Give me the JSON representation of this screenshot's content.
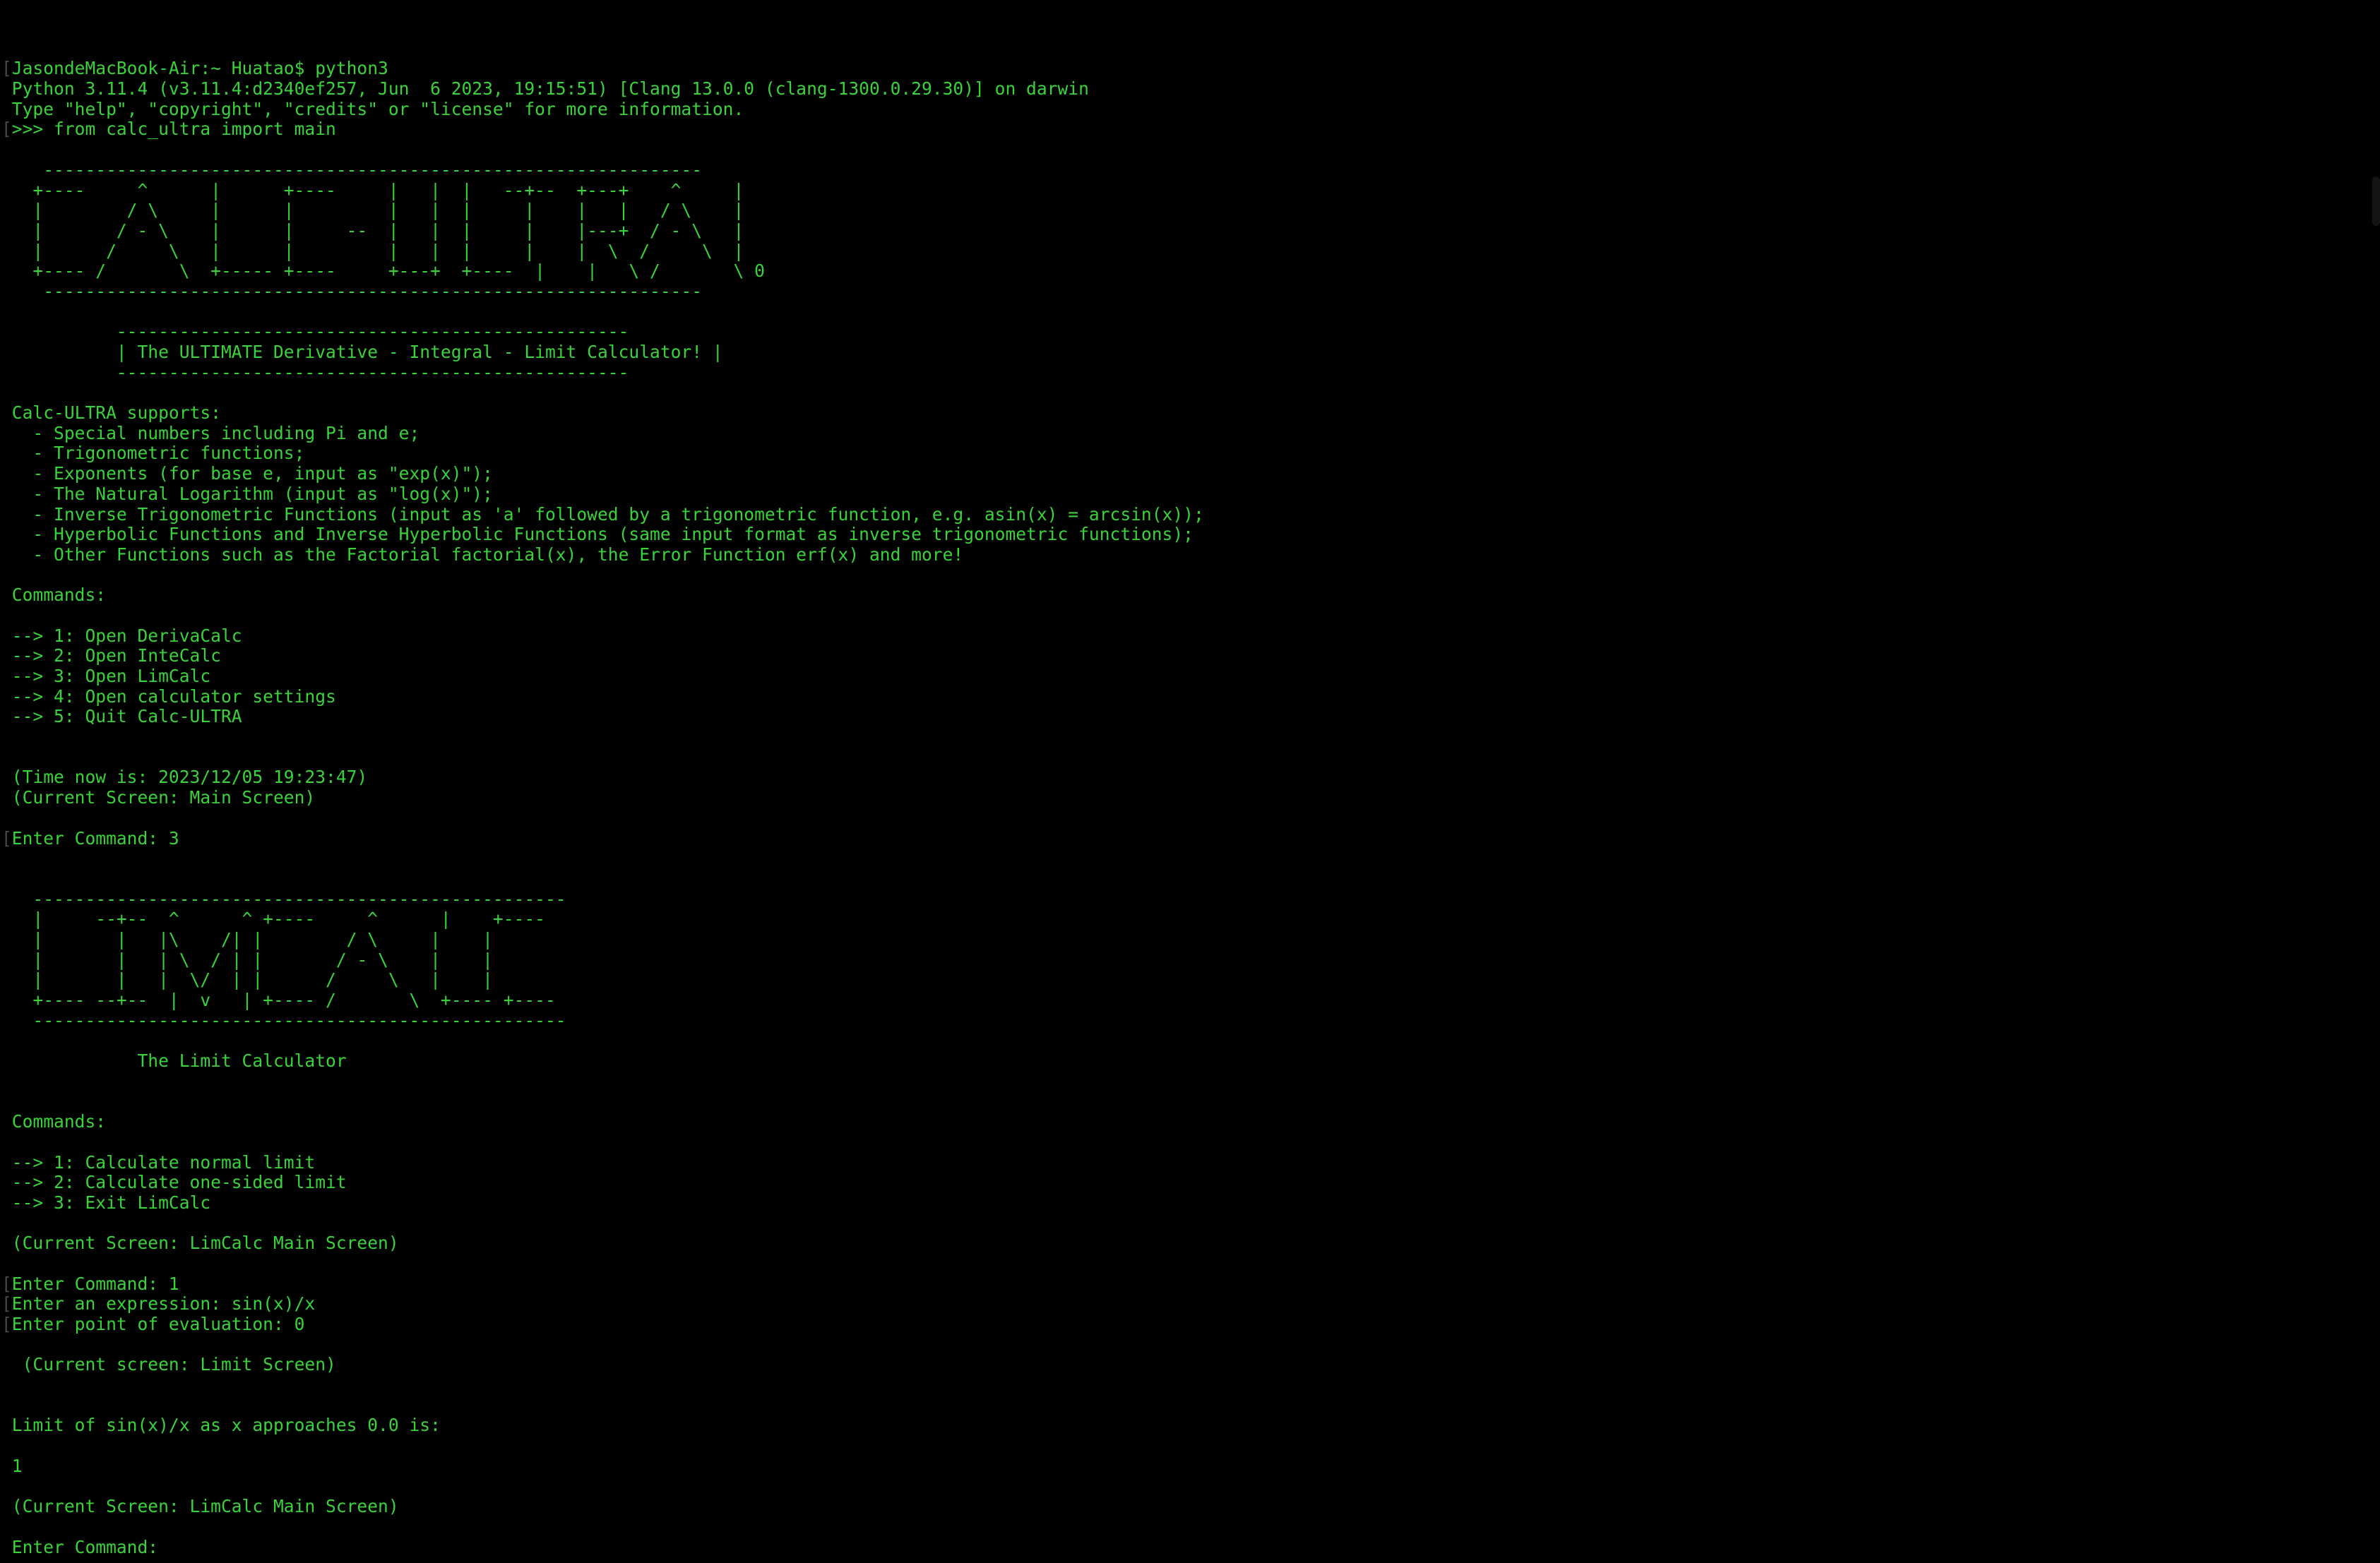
{
  "terminal": {
    "theme": {
      "background": "#000000",
      "foreground": "#3ad23a",
      "prompt_marker": "#4a4a4a",
      "scrollbar": "#141414"
    },
    "prompt_marker_glyph": "[",
    "lines": [
      {
        "text": "JasondeMacBook-Air:~ Huatao$ python3",
        "marker": true,
        "name": "shell-prompt-python3"
      },
      {
        "text": "Python 3.11.4 (v3.11.4:d2340ef257, Jun  6 2023, 19:15:51) [Clang 13.0.0 (clang-1300.0.29.30)] on darwin",
        "marker": false,
        "name": "python-version-banner"
      },
      {
        "text": "Type \"help\", \"copyright\", \"credits\" or \"license\" for more information.",
        "marker": false,
        "name": "python-help-hint"
      },
      {
        "text": ">>> from calc_ultra import main",
        "marker": true,
        "name": "python-import-statement"
      },
      {
        "text": "",
        "marker": false,
        "name": "blank"
      },
      {
        "text": "   ---------------------------------------------------------------",
        "marker": false,
        "name": "calc-ultra-art-top-border"
      },
      {
        "text": "  +----     ^      |      +----     |   |  |   --+--  +---+    ^     |",
        "marker": false,
        "name": "calc-ultra-art-row-1"
      },
      {
        "text": "  |        / \\     |      |         |   |  |     |    |   |   / \\    |",
        "marker": false,
        "name": "calc-ultra-art-row-2"
      },
      {
        "text": "  |       / - \\    |      |     --  |   |  |     |    |---+  / - \\   |",
        "marker": false,
        "name": "calc-ultra-art-row-3"
      },
      {
        "text": "  |      /     \\   |      |         |   |  |     |    |  \\  /     \\  |",
        "marker": false,
        "name": "calc-ultra-art-row-4"
      },
      {
        "text": "  +---- /       \\  +----- +----     +---+  +----  |    |   \\ /       \\ 0",
        "marker": false,
        "name": "calc-ultra-art-row-5"
      },
      {
        "text": "   ---------------------------------------------------------------",
        "marker": false,
        "name": "calc-ultra-art-bottom-border"
      },
      {
        "text": "",
        "marker": false,
        "name": "blank"
      },
      {
        "text": "          -------------------------------------------------",
        "marker": false,
        "name": "tagline-box-top"
      },
      {
        "text": "          | The ULTIMATE Derivative - Integral - Limit Calculator! |",
        "marker": false,
        "name": "tagline-text"
      },
      {
        "text": "          -------------------------------------------------",
        "marker": false,
        "name": "tagline-box-bottom"
      },
      {
        "text": "",
        "marker": false,
        "name": "blank"
      },
      {
        "text": "Calc-ULTRA supports:",
        "marker": false,
        "name": "supports-heading"
      },
      {
        "text": "  - Special numbers including Pi and e;",
        "marker": false,
        "name": "support-item-1"
      },
      {
        "text": "  - Trigonometric functions;",
        "marker": false,
        "name": "support-item-2"
      },
      {
        "text": "  - Exponents (for base e, input as \"exp(x)\");",
        "marker": false,
        "name": "support-item-3"
      },
      {
        "text": "  - The Natural Logarithm (input as \"log(x)\");",
        "marker": false,
        "name": "support-item-4"
      },
      {
        "text": "  - Inverse Trigonometric Functions (input as 'a' followed by a trigonometric function, e.g. asin(x) = arcsin(x));",
        "marker": false,
        "name": "support-item-5"
      },
      {
        "text": "  - Hyperbolic Functions and Inverse Hyperbolic Functions (same input format as inverse trigonometric functions);",
        "marker": false,
        "name": "support-item-6"
      },
      {
        "text": "  - Other Functions such as the Factorial factorial(x), the Error Function erf(x) and more!",
        "marker": false,
        "name": "support-item-7"
      },
      {
        "text": "",
        "marker": false,
        "name": "blank"
      },
      {
        "text": "Commands:",
        "marker": false,
        "name": "main-commands-heading"
      },
      {
        "text": "",
        "marker": false,
        "name": "blank"
      },
      {
        "text": "--> 1: Open DerivaCalc",
        "marker": false,
        "name": "main-command-1"
      },
      {
        "text": "--> 2: Open InteCalc",
        "marker": false,
        "name": "main-command-2"
      },
      {
        "text": "--> 3: Open LimCalc",
        "marker": false,
        "name": "main-command-3"
      },
      {
        "text": "--> 4: Open calculator settings",
        "marker": false,
        "name": "main-command-4"
      },
      {
        "text": "--> 5: Quit Calc-ULTRA",
        "marker": false,
        "name": "main-command-5"
      },
      {
        "text": "",
        "marker": false,
        "name": "blank"
      },
      {
        "text": "",
        "marker": false,
        "name": "blank"
      },
      {
        "text": "(Time now is: 2023/12/05 19:23:47)",
        "marker": false,
        "name": "time-now-status"
      },
      {
        "text": "(Current Screen: Main Screen)",
        "marker": false,
        "name": "current-screen-main"
      },
      {
        "text": "",
        "marker": false,
        "name": "blank"
      },
      {
        "text": "Enter Command: 3",
        "marker": true,
        "name": "enter-command-main-3"
      },
      {
        "text": "",
        "marker": false,
        "name": "blank"
      },
      {
        "text": "",
        "marker": false,
        "name": "blank"
      },
      {
        "text": "  ---------------------------------------------------",
        "marker": false,
        "name": "limcalc-art-top-border"
      },
      {
        "text": "  |     --+--  ^      ^ +----     ^      |    +----",
        "marker": false,
        "name": "limcalc-art-row-1"
      },
      {
        "text": "  |       |   |\\    /| |        / \\     |    |",
        "marker": false,
        "name": "limcalc-art-row-2"
      },
      {
        "text": "  |       |   | \\  / | |       / - \\    |    |",
        "marker": false,
        "name": "limcalc-art-row-3"
      },
      {
        "text": "  |       |   |  \\/  | |      /     \\   |    |",
        "marker": false,
        "name": "limcalc-art-row-4"
      },
      {
        "text": "  +---- --+--  |  v   | +---- /       \\  +---- +----",
        "marker": false,
        "name": "limcalc-art-row-5"
      },
      {
        "text": "  ---------------------------------------------------",
        "marker": false,
        "name": "limcalc-art-bottom-border"
      },
      {
        "text": "",
        "marker": false,
        "name": "blank"
      },
      {
        "text": "            The Limit Calculator",
        "marker": false,
        "name": "limcalc-subtitle"
      },
      {
        "text": "",
        "marker": false,
        "name": "blank"
      },
      {
        "text": "",
        "marker": false,
        "name": "blank"
      },
      {
        "text": "Commands:",
        "marker": false,
        "name": "limcalc-commands-heading"
      },
      {
        "text": "",
        "marker": false,
        "name": "blank"
      },
      {
        "text": "--> 1: Calculate normal limit",
        "marker": false,
        "name": "limcalc-command-1"
      },
      {
        "text": "--> 2: Calculate one-sided limit",
        "marker": false,
        "name": "limcalc-command-2"
      },
      {
        "text": "--> 3: Exit LimCalc",
        "marker": false,
        "name": "limcalc-command-3"
      },
      {
        "text": "",
        "marker": false,
        "name": "blank"
      },
      {
        "text": "(Current Screen: LimCalc Main Screen)",
        "marker": false,
        "name": "current-screen-limcalc-1"
      },
      {
        "text": "",
        "marker": false,
        "name": "blank"
      },
      {
        "text": "Enter Command: 1",
        "marker": true,
        "name": "enter-command-limcalc-1"
      },
      {
        "text": "Enter an expression: sin(x)/x",
        "marker": true,
        "name": "enter-expression"
      },
      {
        "text": "Enter point of evaluation: 0",
        "marker": true,
        "name": "enter-point-of-evaluation"
      },
      {
        "text": "",
        "marker": false,
        "name": "blank"
      },
      {
        "text": " (Current screen: Limit Screen)",
        "marker": false,
        "name": "current-screen-limit"
      },
      {
        "text": "",
        "marker": false,
        "name": "blank"
      },
      {
        "text": "",
        "marker": false,
        "name": "blank"
      },
      {
        "text": "Limit of sin(x)/x as x approaches 0.0 is:",
        "marker": false,
        "name": "limit-result-label"
      },
      {
        "text": "",
        "marker": false,
        "name": "blank"
      },
      {
        "text": "1",
        "marker": false,
        "name": "limit-result-value"
      },
      {
        "text": "",
        "marker": false,
        "name": "blank"
      },
      {
        "text": "(Current Screen: LimCalc Main Screen)",
        "marker": false,
        "name": "current-screen-limcalc-2"
      },
      {
        "text": "",
        "marker": false,
        "name": "blank"
      },
      {
        "text": "Enter Command:",
        "marker": false,
        "name": "enter-command-awaiting-input"
      }
    ]
  }
}
